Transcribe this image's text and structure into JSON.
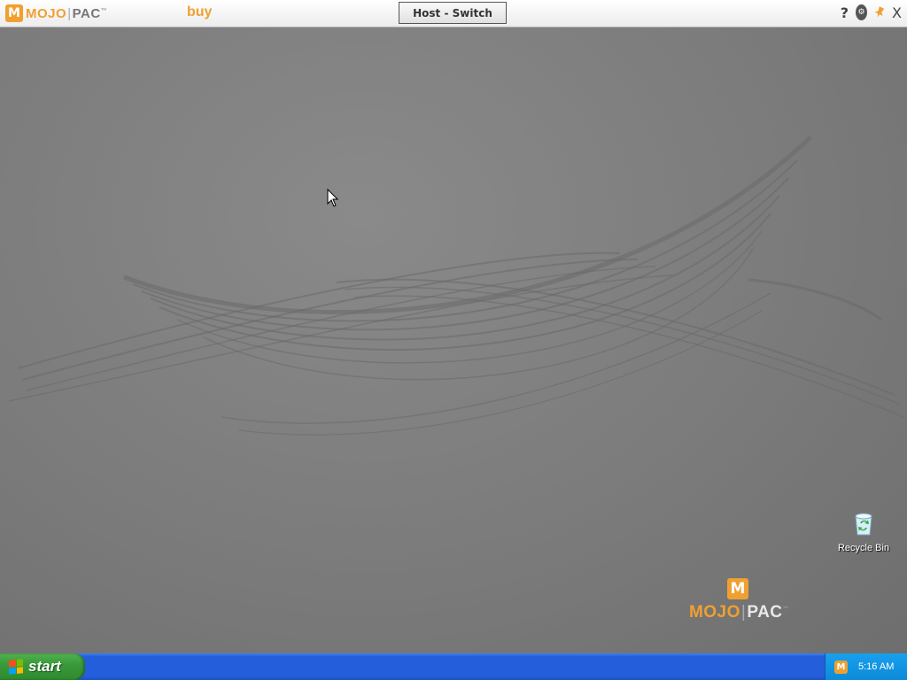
{
  "topbar": {
    "logo_badge": "M",
    "logo_word_a": "MOJO",
    "logo_word_b": "PAC",
    "buy_label": "buy",
    "host_switch_label": "Host - Switch",
    "help_label": "?",
    "close_label": "X"
  },
  "desktop": {
    "icons": [
      {
        "label": "Recycle Bin",
        "icon": "recycle-bin-icon"
      }
    ],
    "watermark": {
      "badge": "M",
      "word_a": "MOJO",
      "word_b": "PAC"
    }
  },
  "taskbar": {
    "start_label": "start",
    "clock": "5:16 AM"
  },
  "colors": {
    "accent": "#f0a030",
    "taskbar": "#245edb",
    "start": "#3a9a3a",
    "tray": "#0d8ad8"
  }
}
